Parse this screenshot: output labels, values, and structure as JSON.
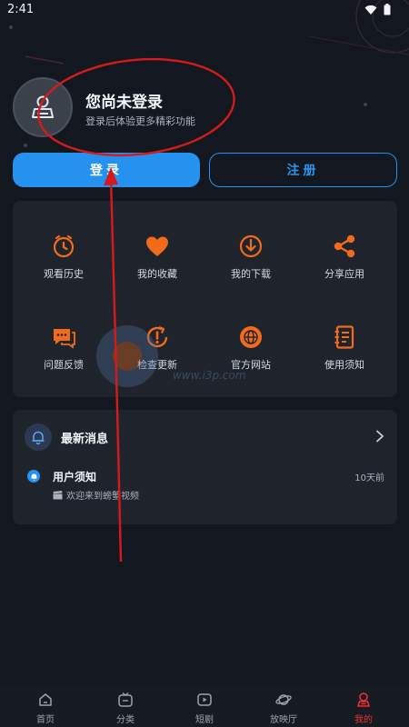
{
  "status_bar": {
    "time": "2:41"
  },
  "profile": {
    "name": "您尚未登录",
    "subtitle": "登录后体验更多精彩功能"
  },
  "auth": {
    "login_label": "登录",
    "register_label": "注册"
  },
  "menu": {
    "items": [
      {
        "label": "观看历史",
        "icon": "clock-icon"
      },
      {
        "label": "我的收藏",
        "icon": "heart-icon"
      },
      {
        "label": "我的下载",
        "icon": "download-icon"
      },
      {
        "label": "分享应用",
        "icon": "share-icon"
      },
      {
        "label": "问题反馈",
        "icon": "feedback-icon"
      },
      {
        "label": "检查更新",
        "icon": "update-icon"
      },
      {
        "label": "官方网站",
        "icon": "globe-icon"
      },
      {
        "label": "使用须知",
        "icon": "notebook-icon"
      }
    ]
  },
  "news": {
    "title": "最新消息",
    "message": {
      "title": "用户须知",
      "time": "10天前",
      "body": "欢迎来到螃蟹视频"
    }
  },
  "watermark": {
    "text": "www.i3p.com"
  },
  "nav": {
    "items": [
      {
        "label": "首页",
        "icon": "home-icon"
      },
      {
        "label": "分类",
        "icon": "tv-icon"
      },
      {
        "label": "短剧",
        "icon": "short-drama-icon"
      },
      {
        "label": "放映厅",
        "icon": "planet-icon"
      },
      {
        "label": "我的",
        "icon": "user-icon",
        "active": true
      }
    ]
  },
  "colors": {
    "accent": "#2592f0",
    "menu_icon": "#f26a1b",
    "active_nav": "#e8303a",
    "background": "#131820"
  }
}
